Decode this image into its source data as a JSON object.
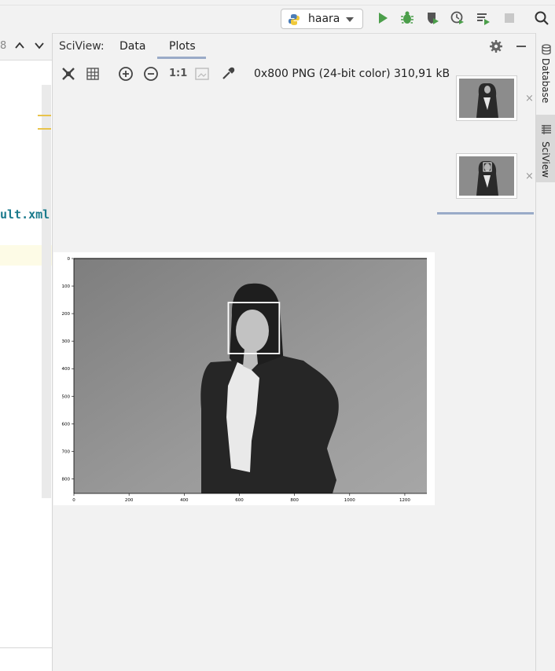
{
  "toolbar": {
    "run_config": "haara",
    "actions": [
      "run-icon",
      "debug-icon",
      "coverage-icon",
      "profile-icon",
      "run-tests-icon",
      "stop-icon",
      "search-icon"
    ],
    "colors": {
      "run": "#4b9e4a",
      "debug": "#4b9e4a",
      "stop": "#c8c8c8"
    }
  },
  "editor": {
    "line_number": "8",
    "code_text": "ult.xml"
  },
  "sciview": {
    "title": "SciView:",
    "tabs": [
      {
        "label": "Data",
        "selected": false
      },
      {
        "label": "Plots",
        "selected": true
      }
    ],
    "image_info": "0x800 PNG (24-bit color) 310,91 kB",
    "zoom_actual": "1:1",
    "thumbnails": [
      {
        "close": "×"
      },
      {
        "close": "×"
      }
    ]
  },
  "side_tabs": [
    "Database",
    "SciView"
  ],
  "chart_data": {
    "type": "image",
    "x_ticks": [
      "0",
      "200",
      "400",
      "600",
      "800",
      "1000",
      "1200"
    ],
    "y_ticks": [
      "0",
      "100",
      "200",
      "300",
      "400",
      "500",
      "600",
      "700",
      "800"
    ],
    "xlim": [
      0,
      1280
    ],
    "ylim": [
      853,
      0
    ],
    "detection_box": {
      "x": 560,
      "y": 160,
      "w": 185,
      "h": 185
    }
  }
}
